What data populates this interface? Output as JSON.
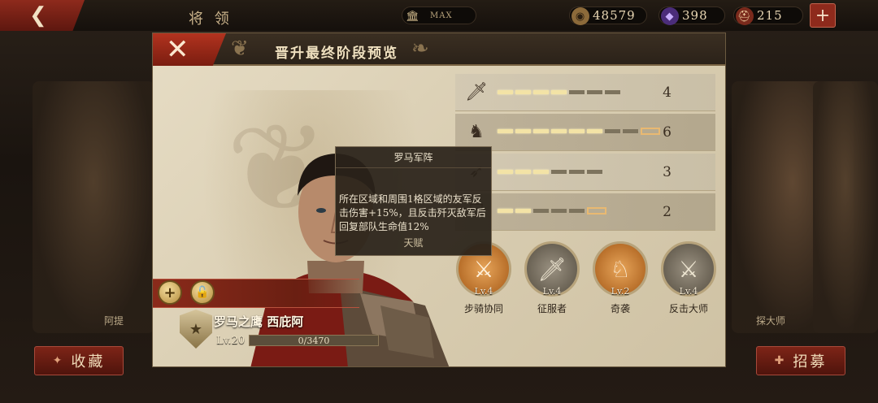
{
  "topbar": {
    "back_icon": "arrow-left-icon",
    "title": "将 领",
    "max_label": "MAX",
    "coins": "48579",
    "gems": "398",
    "troops": "215",
    "plus_icon": "plus-icon"
  },
  "background": {
    "left_hero_label": "阿提",
    "right_hero_label": "探大师"
  },
  "bottom": {
    "favorite_label": "收藏",
    "recruit_label": "招募"
  },
  "modal": {
    "title": "晋升最终阶段预览",
    "close_icon": "close-x-icon"
  },
  "hero": {
    "name": "罗马之鹰 西庇阿",
    "level": "Lv.20",
    "exp": "0/3470"
  },
  "stats": [
    {
      "icon": "sword-icon",
      "value": "4",
      "filled": 4,
      "total": 7,
      "cap": false
    },
    {
      "icon": "horse-icon",
      "value": "6",
      "filled": 6,
      "total": 8,
      "cap": true
    },
    {
      "icon": "bow-icon",
      "value": "3",
      "filled": 3,
      "total": 6,
      "cap": false
    },
    {
      "icon": "shield-icon",
      "value": "2",
      "filled": 2,
      "total": 5,
      "cap": true
    }
  ],
  "skills": [
    {
      "name": "步骑协同",
      "level": "Lv.4",
      "style": "orange",
      "icon": "infantry-cavalry-icon"
    },
    {
      "name": "征服者",
      "level": "Lv.4",
      "style": "grey",
      "icon": "sword-laurel-icon"
    },
    {
      "name": "奇袭",
      "level": "Lv.2",
      "style": "orange",
      "icon": "raid-icon"
    },
    {
      "name": "反击大师",
      "level": "Lv.4",
      "style": "grey",
      "icon": "counter-attack-icon"
    }
  ],
  "tooltip": {
    "title": "罗马军阵",
    "body": "所在区域和周围1格区域的友军反击伤害+15%，且反击歼灭敌军后回复部队生命值12%",
    "footer": "天赋"
  },
  "colors": {
    "accent_red": "#8e2a1c",
    "panel": "#ddd2b8",
    "bar_on": "#f3e3a6"
  }
}
